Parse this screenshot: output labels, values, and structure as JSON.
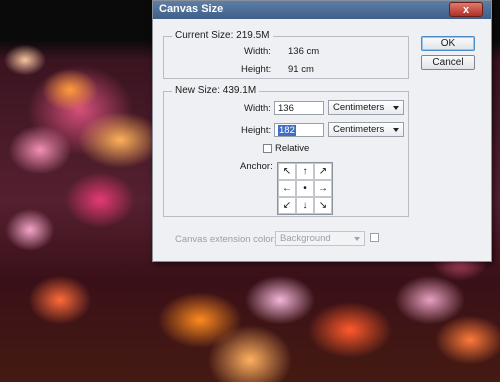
{
  "dialog": {
    "title": "Canvas Size",
    "close_label": "x"
  },
  "current_size": {
    "title": "Current Size: 219.5M",
    "width_label": "Width:",
    "width_value": "136 cm",
    "height_label": "Height:",
    "height_value": "91 cm"
  },
  "new_size": {
    "title": "New Size: 439.1M",
    "width_label": "Width:",
    "width_value": "136",
    "width_unit": "Centimeters",
    "height_label": "Height:",
    "height_value": "182",
    "height_unit": "Centimeters",
    "relative_label": "Relative",
    "relative_checked": false,
    "anchor_label": "Anchor:",
    "anchor_cells": [
      "↖",
      "↑",
      "↗",
      "←",
      "•",
      "→",
      "↙",
      "↓",
      "↘"
    ]
  },
  "buttons": {
    "ok": "OK",
    "cancel": "Cancel"
  },
  "extension": {
    "label": "Canvas extension color:",
    "value": "Background"
  }
}
